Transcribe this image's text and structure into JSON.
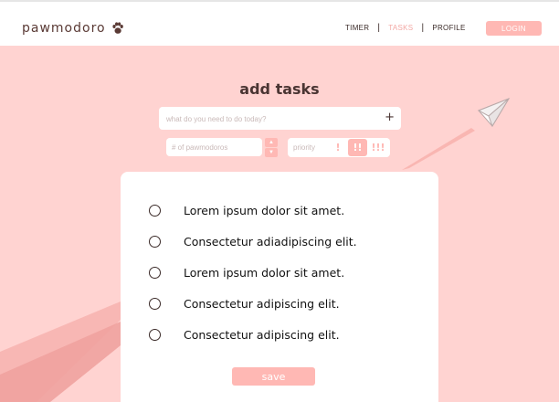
{
  "app": {
    "logo_text": "pawmodoro",
    "logo_icon": "paw-icon"
  },
  "nav": {
    "items": [
      {
        "label": "TIMER",
        "active": false
      },
      {
        "label": "TASKS",
        "active": true
      },
      {
        "label": "PROFILE",
        "active": false
      }
    ],
    "login_label": "LOGIN"
  },
  "main": {
    "title": "add tasks",
    "task_input": {
      "placeholder": "what do you need to do today?",
      "value": ""
    },
    "add_icon": "+",
    "pomodoros": {
      "placeholder": "# of pawmodoros",
      "value": ""
    },
    "stepper": {
      "up": "▲",
      "down": "▼"
    },
    "priority": {
      "label": "priority",
      "options": [
        "!",
        "!!",
        "!!!"
      ],
      "selected": "!!"
    }
  },
  "tasks": [
    {
      "text": "Lorem ipsum dolor sit amet.",
      "done": false
    },
    {
      "text": "Consectetur adiadipiscing elit.",
      "done": false
    },
    {
      "text": "Lorem ipsum dolor sit amet.",
      "done": false
    },
    {
      "text": "Consectetur adipiscing elit.",
      "done": false
    },
    {
      "text": "Consectetur adipiscing elit.",
      "done": false
    }
  ],
  "save_label": "save",
  "colors": {
    "background": "#ffd3d1",
    "accent": "#ffb8b4",
    "active_nav": "#f3a8a4",
    "brand_text": "#5a3a35"
  }
}
